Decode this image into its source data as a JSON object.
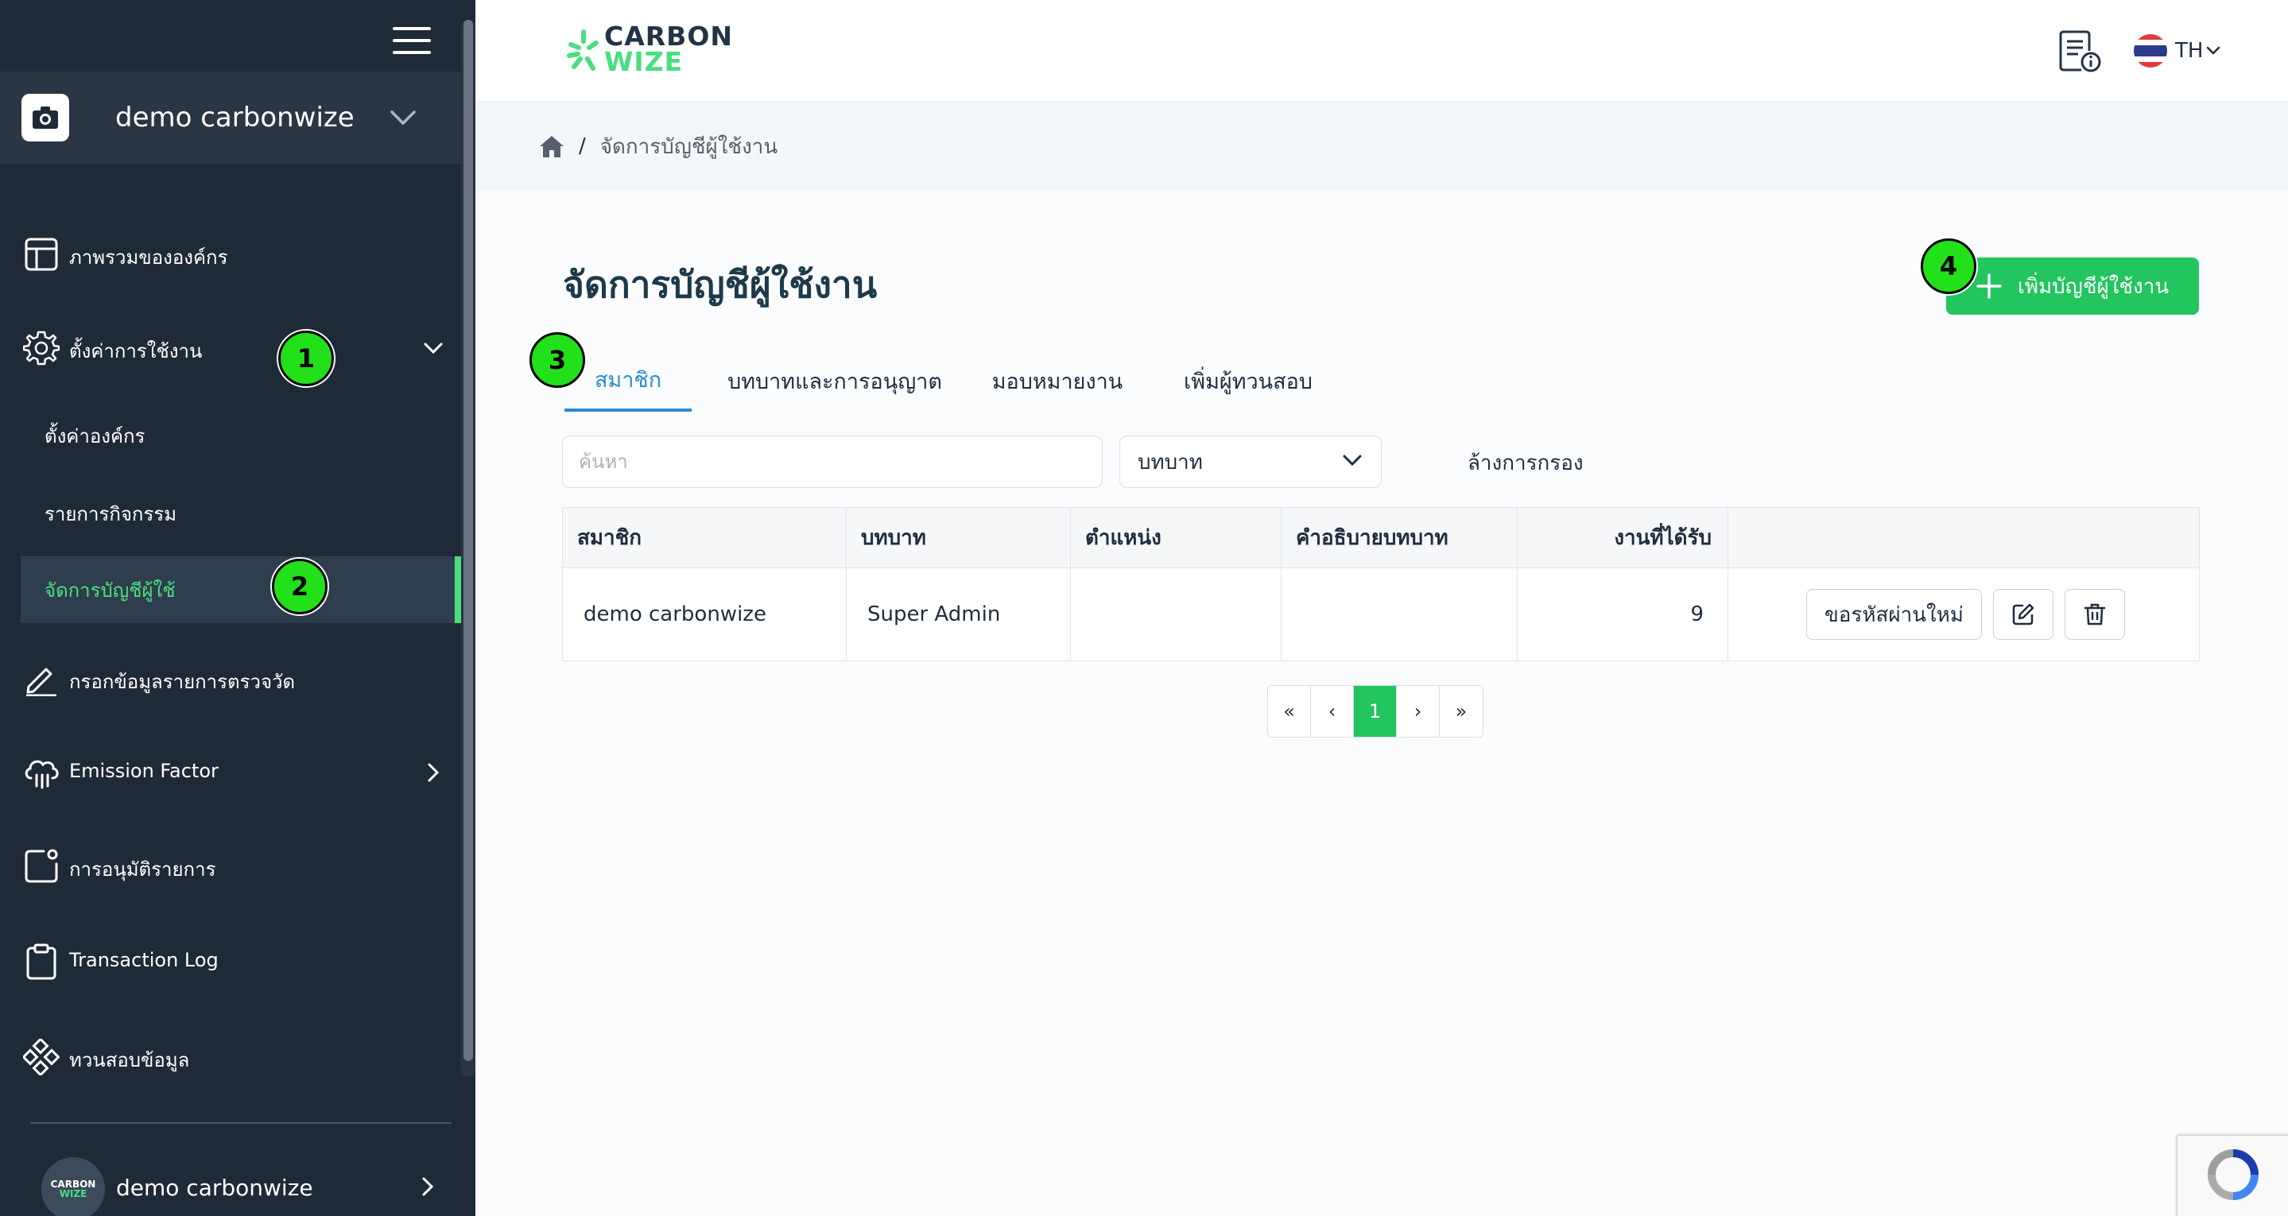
{
  "sidebar": {
    "org_name": "demo carbonwize",
    "items": [
      {
        "label": "ภาพรวมขององค์กร"
      },
      {
        "label": "ตั้งค่าการใช้งาน"
      },
      {
        "label": "กรอกข้อมูลรายการตรวจวัด"
      },
      {
        "label": "Emission Factor"
      },
      {
        "label": "การอนุมัติรายการ"
      },
      {
        "label": "Transaction Log"
      },
      {
        "label": "ทวนสอบข้อมูล"
      }
    ],
    "sub_items": [
      {
        "label": "ตั้งค่าองค์กร"
      },
      {
        "label": "รายการกิจกรรม"
      },
      {
        "label": "จัดการบัญชีผู้ใช้",
        "active": true
      }
    ],
    "profile": {
      "name": "demo carbonwize",
      "avatar_line1": "CARBON",
      "avatar_line2": "WIZE"
    },
    "accent_color": "#4ade80"
  },
  "header": {
    "logo_line1": "CARBON",
    "logo_line2": "WIZE",
    "language": "TH"
  },
  "breadcrumb": {
    "current": "จัดการบัญชีผู้ใช้งาน",
    "separator": "/"
  },
  "main": {
    "title": "จัดการบัญชีผู้ใช้งาน",
    "add_button_label": "เพิ่มบัญชีผู้ใช้งาน",
    "tabs": [
      {
        "label": "สมาชิก",
        "active": true
      },
      {
        "label": "บทบาทและการอนุญาต"
      },
      {
        "label": "มอบหมายงาน"
      },
      {
        "label": "เพิ่มผู้ทวนสอบ"
      }
    ],
    "search_placeholder": "ค้นหา",
    "role_select_value": "บทบาท",
    "clear_filter_label": "ล้างการกรอง",
    "table": {
      "headers": [
        "สมาชิก",
        "บทบาท",
        "ตำแหน่ง",
        "คำอธิบายบทบาท",
        "งานที่ได้รับ",
        ""
      ],
      "rows": [
        {
          "member": "demo carbonwize",
          "role": "Super Admin",
          "position": "",
          "role_description": "",
          "tasks_received": "9",
          "reset_label": "ขอรหัสผ่านใหม่"
        }
      ]
    },
    "pagination": {
      "first": "«",
      "prev": "‹",
      "current": "1",
      "next": "›",
      "last": "»"
    },
    "primary_color": "#22c55e",
    "tab_active_color": "#2a8bd0"
  },
  "markers": [
    "1",
    "2",
    "3",
    "4"
  ]
}
